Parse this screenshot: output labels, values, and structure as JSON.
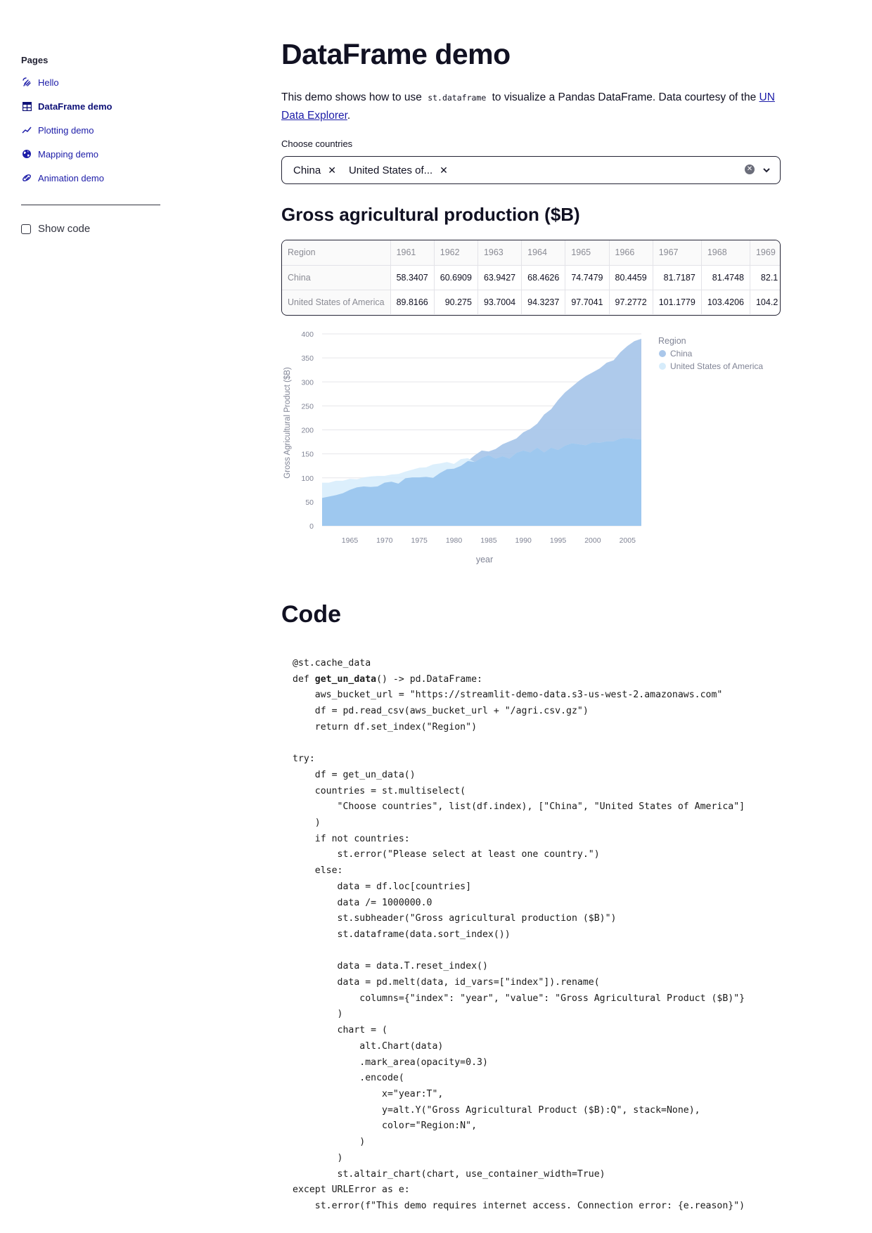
{
  "sidebar": {
    "section_label": "Pages",
    "items": [
      {
        "label": "Hello",
        "icon": "wave-hand-icon",
        "active": false
      },
      {
        "label": "DataFrame demo",
        "icon": "table-icon",
        "active": true
      },
      {
        "label": "Plotting demo",
        "icon": "line-chart-icon",
        "active": false
      },
      {
        "label": "Mapping demo",
        "icon": "globe-icon",
        "active": false
      },
      {
        "label": "Animation demo",
        "icon": "animation-icon",
        "active": false
      }
    ],
    "show_code_label": "Show code",
    "show_code_checked": false
  },
  "main": {
    "title": "DataFrame demo",
    "intro": {
      "before_code": "This demo shows how to use ",
      "code": "st.dataframe",
      "after_code": " to visualize a Pandas DataFrame. Data courtesy of the ",
      "link_text": "UN Data Explorer",
      "after_link": "."
    },
    "multiselect": {
      "label": "Choose countries",
      "tags": [
        "China",
        "United States of..."
      ]
    },
    "subheader": "Gross agricultural production ($B)",
    "table": {
      "columns": [
        "Region",
        "1961",
        "1962",
        "1963",
        "1964",
        "1965",
        "1966",
        "1967",
        "1968",
        "1969"
      ],
      "rows": [
        {
          "region": "China",
          "values": [
            "58.3407",
            "60.6909",
            "63.9427",
            "68.4626",
            "74.7479",
            "80.4459",
            "81.7187",
            "81.4748",
            "82.1"
          ]
        },
        {
          "region": "United States of America",
          "values": [
            "89.8166",
            "90.275",
            "93.7004",
            "94.3237",
            "97.7041",
            "97.2772",
            "101.1779",
            "103.4206",
            "104.2"
          ]
        }
      ]
    },
    "code_title": "Code"
  },
  "chart_data": {
    "type": "area",
    "xlabel": "year",
    "ylabel": "Gross Agricultural Product ($B)",
    "ylim": [
      0,
      400
    ],
    "yticks": [
      0,
      50,
      100,
      150,
      200,
      250,
      300,
      350,
      400
    ],
    "xticks": [
      1965,
      1970,
      1975,
      1980,
      1985,
      1990,
      1995,
      2000,
      2005
    ],
    "x": [
      1961,
      1962,
      1963,
      1964,
      1965,
      1966,
      1967,
      1968,
      1969,
      1970,
      1971,
      1972,
      1973,
      1974,
      1975,
      1976,
      1977,
      1978,
      1979,
      1980,
      1981,
      1982,
      1983,
      1984,
      1985,
      1986,
      1987,
      1988,
      1989,
      1990,
      1991,
      1992,
      1993,
      1994,
      1995,
      1996,
      1997,
      1998,
      1999,
      2000,
      2001,
      2002,
      2003,
      2004,
      2005,
      2006,
      2007
    ],
    "legend_title": "Region",
    "legend_position": "top-right",
    "grid": true,
    "series": [
      {
        "name": "China",
        "color": "#aac7ea",
        "values": [
          58,
          61,
          64,
          68,
          75,
          80,
          82,
          81,
          82,
          90,
          92,
          88,
          99,
          101,
          101,
          102,
          100,
          110,
          118,
          119,
          125,
          135,
          147,
          157,
          155,
          160,
          170,
          176,
          182,
          195,
          202,
          213,
          232,
          243,
          262,
          278,
          290,
          302,
          312,
          320,
          328,
          340,
          345,
          362,
          375,
          385,
          390
        ]
      },
      {
        "name": "United States of America",
        "color": "#d6ecfb",
        "values": [
          90,
          90,
          94,
          94,
          98,
          97,
          101,
          103,
          104,
          104,
          107,
          108,
          113,
          117,
          121,
          122,
          128,
          130,
          133,
          129,
          139,
          141,
          133,
          142,
          147,
          140,
          145,
          140,
          152,
          157,
          153,
          163,
          153,
          163,
          158,
          167,
          172,
          170,
          168,
          174,
          173,
          176,
          176,
          182,
          183,
          181,
          180
        ]
      }
    ]
  },
  "code": {
    "lines": [
      "@st.cache_data",
      "def §get_un_data§() -> pd.DataFrame:",
      "    aws_bucket_url = \"https://streamlit-demo-data.s3-us-west-2.amazonaws.com\"",
      "    df = pd.read_csv(aws_bucket_url + \"/agri.csv.gz\")",
      "    return df.set_index(\"Region\")",
      "",
      "try:",
      "    df = get_un_data()",
      "    countries = st.multiselect(",
      "        \"Choose countries\", list(df.index), [\"China\", \"United States of America\"]",
      "    )",
      "    if not countries:",
      "        st.error(\"Please select at least one country.\")",
      "    else:",
      "        data = df.loc[countries]",
      "        data /= 1000000.0",
      "        st.subheader(\"Gross agricultural production ($B)\")",
      "        st.dataframe(data.sort_index())",
      "",
      "        data = data.T.reset_index()",
      "        data = pd.melt(data, id_vars=[\"index\"]).rename(",
      "            columns={\"index\": \"year\", \"value\": \"Gross Agricultural Product ($B)\"}",
      "        )",
      "        chart = (",
      "            alt.Chart(data)",
      "            .mark_area(opacity=0.3)",
      "            .encode(",
      "                x=\"year:T\",",
      "                y=alt.Y(\"Gross Agricultural Product ($B):Q\", stack=None),",
      "                color=\"Region:N\",",
      "            )",
      "        )",
      "        st.altair_chart(chart, use_container_width=True)",
      "except URLError as e:",
      "    st.error(f\"This demo requires internet access. Connection error: {e.reason}\")"
    ]
  }
}
